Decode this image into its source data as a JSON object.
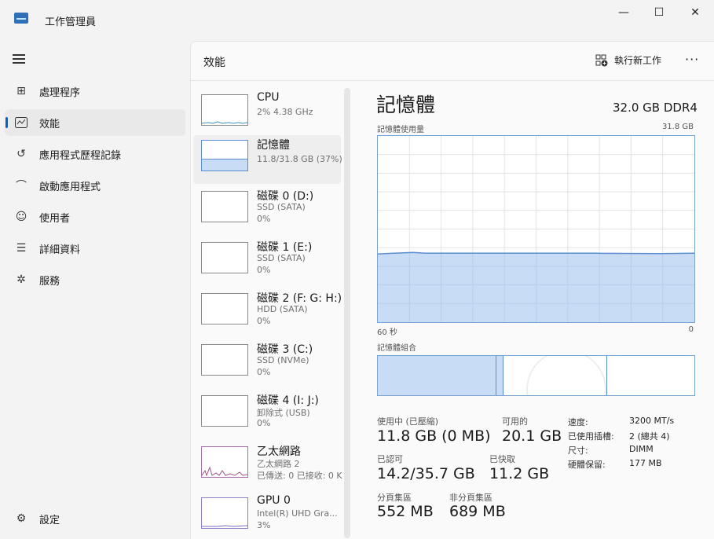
{
  "app": {
    "title": "工作管理員"
  },
  "window_controls": {
    "minimize": "—",
    "maximize": "☐",
    "close": "✕"
  },
  "sidebar": {
    "menu_icon": "hamburger-icon",
    "items": [
      {
        "label": "處理程序",
        "icon": "processes-icon",
        "glyph": "⊞"
      },
      {
        "label": "效能",
        "icon": "performance-icon",
        "glyph": "⌇"
      },
      {
        "label": "應用程式歷程記錄",
        "icon": "history-icon",
        "glyph": "↺"
      },
      {
        "label": "啟動應用程式",
        "icon": "startup-icon",
        "glyph": "⌒"
      },
      {
        "label": "使用者",
        "icon": "users-icon",
        "glyph": "☺"
      },
      {
        "label": "詳細資料",
        "icon": "details-icon",
        "glyph": "☰"
      },
      {
        "label": "服務",
        "icon": "services-icon",
        "glyph": "✲"
      }
    ],
    "settings": {
      "label": "設定",
      "icon": "settings-icon",
      "glyph": "⚙"
    }
  },
  "header": {
    "title": "效能",
    "run_new_task": "執行新工作",
    "more": "···"
  },
  "perf_list": [
    {
      "name": "CPU",
      "line1": "2% 4.38 GHz",
      "line2": ""
    },
    {
      "name": "記憶體",
      "line1": "11.8/31.8 GB (37%)",
      "line2": ""
    },
    {
      "name": "磁碟 0 (D:)",
      "line1": "SSD (SATA)",
      "line2": "0%"
    },
    {
      "name": "磁碟 1 (E:)",
      "line1": "SSD (SATA)",
      "line2": "0%"
    },
    {
      "name": "磁碟 2 (F: G: H:)",
      "line1": "HDD (SATA)",
      "line2": "0%"
    },
    {
      "name": "磁碟 3 (C:)",
      "line1": "SSD (NVMe)",
      "line2": "0%"
    },
    {
      "name": "磁碟 4 (I: J:)",
      "line1": "卸除式 (USB)",
      "line2": "0%"
    },
    {
      "name": "乙太網路",
      "line1": "乙太網路 2",
      "line2": "已傳送: 0 已接收: 0 K"
    },
    {
      "name": "GPU 0",
      "line1": "Intel(R) UHD Gra...",
      "line2": "3%"
    }
  ],
  "memory": {
    "title": "記憶體",
    "spec": "32.0 GB DDR4",
    "usage_label": "記憶體使用量",
    "usage_max": "31.8 GB",
    "axis_left": "60 秒",
    "axis_right": "0",
    "composition_label": "記憶體組合",
    "usage_fraction": 0.37,
    "stats": {
      "in_use_label": "使用中 (已壓縮)",
      "in_use_value": "11.8 GB (0 MB)",
      "available_label": "可用的",
      "available_value": "20.1 GB",
      "committed_label": "已認可",
      "committed_value": "14.2/35.7 GB",
      "cached_label": "已快取",
      "cached_value": "11.2 GB",
      "paged_label": "分頁集區",
      "paged_value": "552 MB",
      "nonpaged_label": "非分頁集區",
      "nonpaged_value": "689 MB"
    },
    "info": [
      {
        "k": "速度:",
        "v": "3200 MT/s"
      },
      {
        "k": "已使用插槽:",
        "v": "2 (總共 4)"
      },
      {
        "k": "尺寸:",
        "v": "DIMM"
      },
      {
        "k": "硬體保留:",
        "v": "177 MB"
      }
    ]
  },
  "colors": {
    "accent": "#0067c0",
    "memory_fill": "#c9dcf5",
    "memory_line": "#5a8ccf"
  }
}
